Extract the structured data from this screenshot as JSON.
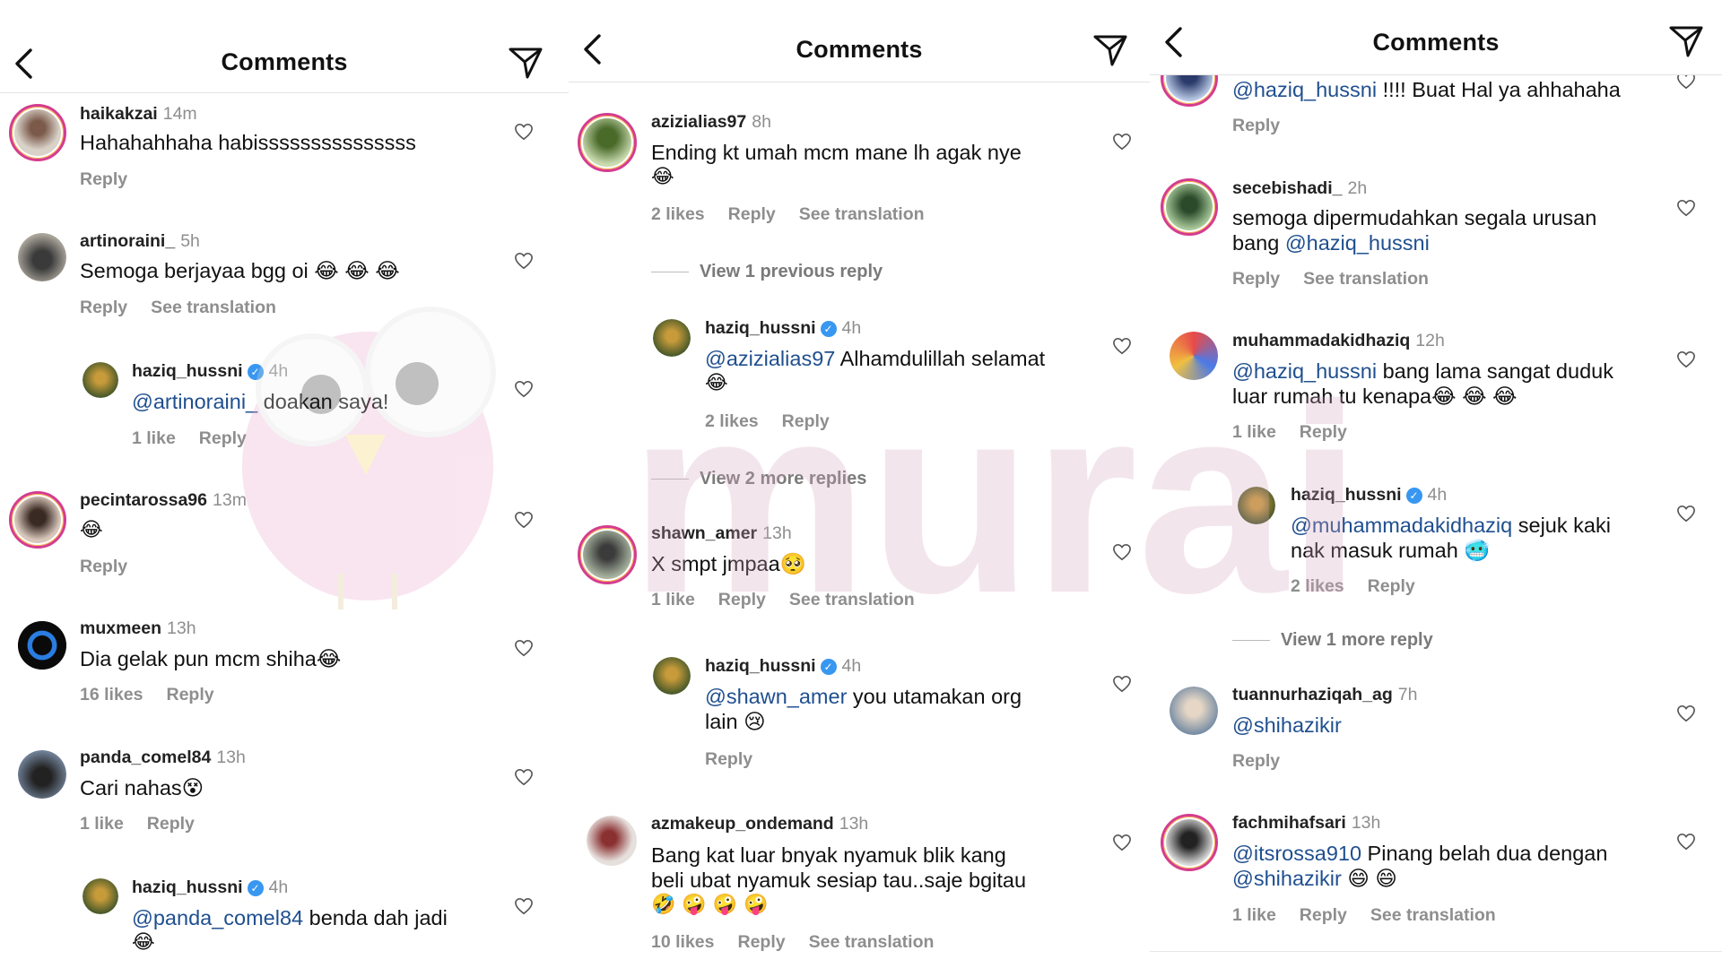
{
  "header": {
    "title": "Comments"
  },
  "actions": {
    "reply": "Reply",
    "see_translation": "See translation"
  },
  "panel1": {
    "comments": [
      {
        "user": "haikakzai",
        "time": "14m",
        "text": "Hahahahhaha habisssssssssssssss",
        "meta": "",
        "tr": false
      },
      {
        "user": "artinoraini_",
        "time": "5h",
        "text": "Semoga berjayaa bgg oi 😂 😂 😂",
        "meta": "",
        "tr": true
      },
      {
        "user": "haziq_hussni",
        "time": "4h",
        "mention": "@artinoraini_",
        "text": " doakan saya!",
        "meta": "1 like",
        "tr": false,
        "verified": true
      },
      {
        "user": "pecintarossa96",
        "time": "13m",
        "text": "😂",
        "meta": "",
        "tr": false
      },
      {
        "user": "muxmeen",
        "time": "13h",
        "text": "Dia gelak pun mcm shiha😂",
        "meta": "16 likes",
        "tr": false
      },
      {
        "user": "panda_comel84",
        "time": "13h",
        "text": "Cari nahas😵",
        "meta": "1 like",
        "tr": false
      },
      {
        "user": "haziq_hussni",
        "time": "4h",
        "mention": "@panda_comel84",
        "text": " benda dah jadi",
        "text2": "😂",
        "meta": "",
        "tr": false,
        "verified": true
      }
    ]
  },
  "panel2": {
    "comments": [
      {
        "user": "azizialias97",
        "time": "8h",
        "text": "Ending kt umah mcm mane lh agak nye",
        "text2": "😂",
        "meta": "2 likes",
        "tr": true
      },
      {
        "user": "haziq_hussni",
        "time": "4h",
        "mention": "@azizialias97",
        "text": " Alhamdulillah selamat",
        "text2": "😂",
        "meta": "2 likes",
        "tr": false,
        "verified": true
      },
      {
        "user": "shawn_amer",
        "time": "13h",
        "text": "X smpt jmpaa🥺",
        "meta": "1 like",
        "tr": true
      },
      {
        "user": "haziq_hussni",
        "time": "4h",
        "mention": "@shawn_amer",
        "text": " you utamakan org",
        "text2": "lain 😢",
        "meta": "",
        "tr": false,
        "verified": true
      },
      {
        "user": "azmakeup_ondemand",
        "time": "13h",
        "text": "Bang kat luar bnyak nyamuk blik kang",
        "text2": "beli ubat nyamuk sesiap tau..saje bgitau",
        "text3": "🤣 🤪 🤪 🤪",
        "meta": "10 likes",
        "tr": true
      }
    ],
    "view_previous": "View 1 previous reply",
    "view_more": "View 2 more replies"
  },
  "panel3": {
    "comments": [
      {
        "user": "",
        "time": "",
        "mention": "@haziq_hussni",
        "text": " !!!! Buat Hal ya ahhahaha",
        "meta": "",
        "tr": false
      },
      {
        "user": "secebishadi_",
        "time": "2h",
        "text": "semoga dipermudahkan segala urusan",
        "text2pre": "bang ",
        "mention2": "@haziq_hussni",
        "meta": "",
        "tr": true
      },
      {
        "user": "muhammadakidhaziq",
        "time": "12h",
        "mention": "@haziq_hussni",
        "text": " bang lama sangat duduk",
        "text2": "luar rumah tu kenapa😂 😂 😂",
        "meta": "1 like",
        "tr": false
      },
      {
        "user": "haziq_hussni",
        "time": "4h",
        "mention": "@muhammadakidhaziq",
        "text": " sejuk kaki",
        "text2": "nak masuk rumah 🥶",
        "meta": "2 likes",
        "tr": false,
        "verified": true
      },
      {
        "user": "tuannurhaziqah_ag",
        "time": "7h",
        "mention": "@shihazikir",
        "text": "",
        "meta": "",
        "tr": false
      },
      {
        "user": "fachmihafsari",
        "time": "13h",
        "mention": "@itsrossa910",
        "text": " Pinang belah dua dengan",
        "mention2": "@shihazikir",
        "text2post": " 😄 😄",
        "meta": "1 like",
        "tr": true
      }
    ],
    "view_more": "View 1 more reply"
  },
  "watermark": {
    "text": "murai"
  },
  "colors": {
    "mention": "#1f4f8f",
    "ring": "#d43c8f",
    "verified": "#3897f0",
    "muted": "#8e8e8e"
  }
}
